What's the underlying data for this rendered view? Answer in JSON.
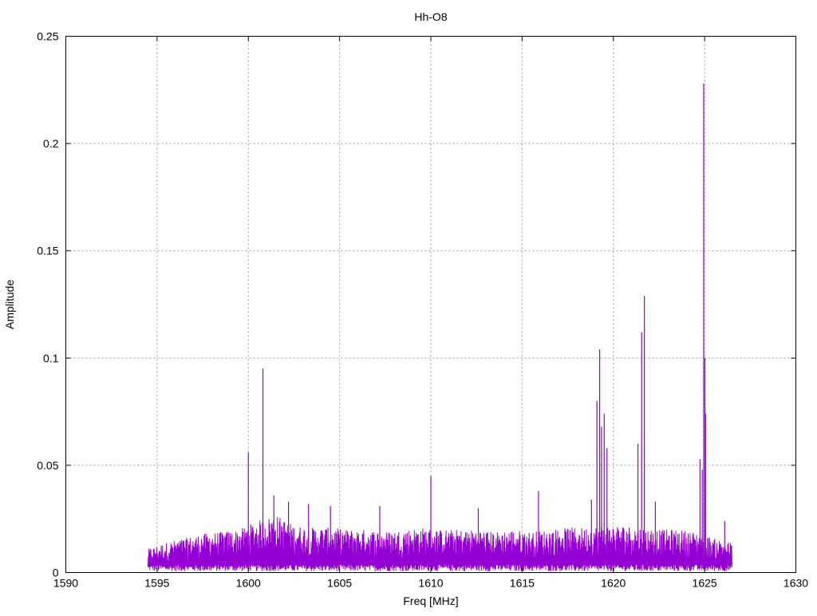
{
  "chart_data": {
    "type": "line",
    "title": "Hh-O8",
    "xlabel": "Freq [MHz]",
    "ylabel": "Amplitude",
    "xlim": [
      1590,
      1630
    ],
    "ylim": [
      0,
      0.25
    ],
    "xticks": [
      "1590",
      "1595",
      "1600",
      "1605",
      "1610",
      "1615",
      "1620",
      "1625",
      "1630"
    ],
    "yticks": [
      "0",
      "0.05",
      "0.1",
      "0.15",
      "0.2",
      "0.25"
    ],
    "grid": true,
    "color": "#9400d3",
    "series": [
      {
        "name": "Hh-O8",
        "x_start": 1594.5,
        "x_end": 1626.5,
        "noise_floor": 0.002,
        "envelope_step_mhz": 1,
        "envelope": [
          0.011,
          0.014,
          0.016,
          0.018,
          0.019,
          0.02,
          0.024,
          0.027,
          0.022,
          0.021,
          0.021,
          0.02,
          0.02,
          0.019,
          0.02,
          0.021,
          0.02,
          0.02,
          0.02,
          0.019,
          0.02,
          0.019,
          0.02,
          0.021,
          0.021,
          0.022,
          0.022,
          0.021,
          0.02,
          0.02,
          0.019,
          0.016,
          0.014
        ],
        "peaks": [
          {
            "x": 1600.0,
            "y": 0.056
          },
          {
            "x": 1600.8,
            "y": 0.095
          },
          {
            "x": 1601.4,
            "y": 0.036
          },
          {
            "x": 1602.2,
            "y": 0.033
          },
          {
            "x": 1603.3,
            "y": 0.032
          },
          {
            "x": 1604.5,
            "y": 0.031
          },
          {
            "x": 1607.2,
            "y": 0.031
          },
          {
            "x": 1610.0,
            "y": 0.045
          },
          {
            "x": 1612.6,
            "y": 0.03
          },
          {
            "x": 1615.9,
            "y": 0.038
          },
          {
            "x": 1618.8,
            "y": 0.034
          },
          {
            "x": 1619.1,
            "y": 0.08
          },
          {
            "x": 1619.25,
            "y": 0.104
          },
          {
            "x": 1619.35,
            "y": 0.068
          },
          {
            "x": 1619.5,
            "y": 0.074
          },
          {
            "x": 1619.65,
            "y": 0.058
          },
          {
            "x": 1621.35,
            "y": 0.06
          },
          {
            "x": 1621.55,
            "y": 0.112
          },
          {
            "x": 1621.7,
            "y": 0.129
          },
          {
            "x": 1622.3,
            "y": 0.033
          },
          {
            "x": 1624.75,
            "y": 0.053
          },
          {
            "x": 1624.87,
            "y": 0.048
          },
          {
            "x": 1624.95,
            "y": 0.228
          },
          {
            "x": 1625.02,
            "y": 0.1
          },
          {
            "x": 1625.05,
            "y": 0.074
          },
          {
            "x": 1626.1,
            "y": 0.024
          }
        ]
      }
    ]
  }
}
